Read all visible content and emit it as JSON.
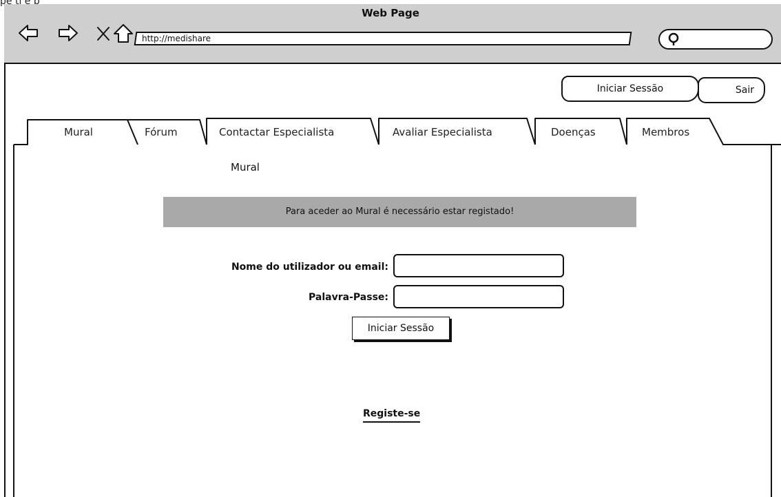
{
  "page_label": "pe ti e p",
  "window": {
    "title": "Web Page"
  },
  "browser": {
    "url": "http://medishare",
    "nav_icons": [
      "back-arrow-icon",
      "forward-arrow-icon",
      "close-icon",
      "home-icon"
    ],
    "search_icon": "search-icon"
  },
  "header": {
    "login_label": "Iniciar Sessão",
    "logout_label": "Sair"
  },
  "tabs": [
    {
      "label": "Mural",
      "active": true
    },
    {
      "label": "Fórum",
      "active": false
    },
    {
      "label": "Contactar Especialista",
      "active": false
    },
    {
      "label": "Avaliar Especialista",
      "active": false
    },
    {
      "label": "Doenças",
      "active": false
    },
    {
      "label": "Membros",
      "active": false
    }
  ],
  "panel": {
    "title": "Mural",
    "notice": "Para aceder ao Mural  é necessário estar registado!",
    "form": {
      "username_label": "Nome do utilizador ou email:",
      "username_value": "",
      "password_label": "Palavra-Passe:",
      "password_value": "",
      "submit_label": "Iniciar Sessão"
    },
    "register_link": "Registe-se"
  },
  "colors": {
    "chrome": "#cfcfcf",
    "notice_bg": "#a9a9a9",
    "ink": "#111111"
  }
}
